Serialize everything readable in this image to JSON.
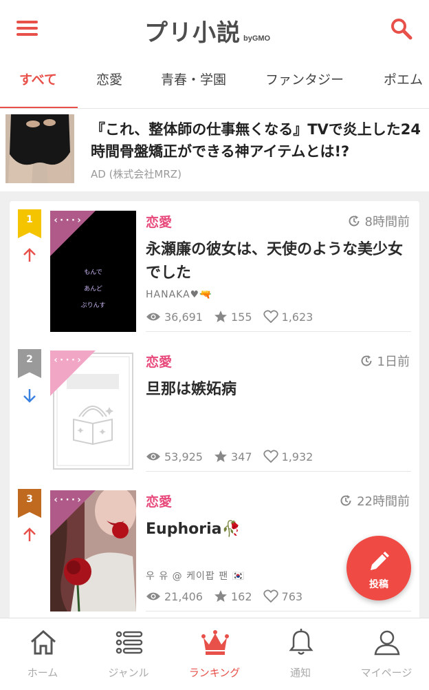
{
  "header": {
    "logo_main": "プリ小説",
    "logo_sub": "byGMO"
  },
  "tabs": [
    {
      "label": "すべて",
      "active": true
    },
    {
      "label": "恋愛"
    },
    {
      "label": "青春・学園"
    },
    {
      "label": "ファンタジー"
    },
    {
      "label": "ポエム"
    }
  ],
  "ad": {
    "title": "『これ、整体師の仕事無くなる』TVで炎上した24時間骨盤矯正ができる神アイテムとは!?",
    "sponsor": "AD (株式会社MRZ)"
  },
  "ranking": [
    {
      "rank": "1",
      "rank_color": "#f5c400",
      "trend": "up",
      "genre": "恋愛",
      "time": "8時間前",
      "title": "永瀬廉の彼女は、天使のような美少女でした",
      "author": "HANAKA♥🔫",
      "views": "36,691",
      "stars": "155",
      "likes": "1,623",
      "cover_text": [
        "もんで",
        "あんど",
        "ぷりんす"
      ]
    },
    {
      "rank": "2",
      "rank_color": "#9a9a9a",
      "trend": "down",
      "genre": "恋愛",
      "time": "1日前",
      "title": "旦那は嫉妬病",
      "author": "",
      "views": "53,925",
      "stars": "347",
      "likes": "1,932"
    },
    {
      "rank": "3",
      "rank_color": "#c06a1f",
      "trend": "up",
      "genre": "恋愛",
      "time": "22時間前",
      "title": "Euphoria🥀",
      "author": "우 유 @ 케이팝 팬 🇰🇷",
      "views": "21,406",
      "stars": "162",
      "likes": "763"
    }
  ],
  "fab": {
    "label": "投稿"
  },
  "bottom_nav": [
    {
      "label": "ホーム",
      "icon": "home-icon"
    },
    {
      "label": "ジャンル",
      "icon": "list-icon"
    },
    {
      "label": "ランキング",
      "icon": "crown-icon",
      "active": true
    },
    {
      "label": "通知",
      "icon": "bell-icon"
    },
    {
      "label": "マイページ",
      "icon": "user-icon"
    }
  ],
  "colors": {
    "accent": "#e8504a",
    "genre": "#e84a7c",
    "badge_dark": "#b05a8a",
    "badge_light": "#f2a6c6"
  }
}
